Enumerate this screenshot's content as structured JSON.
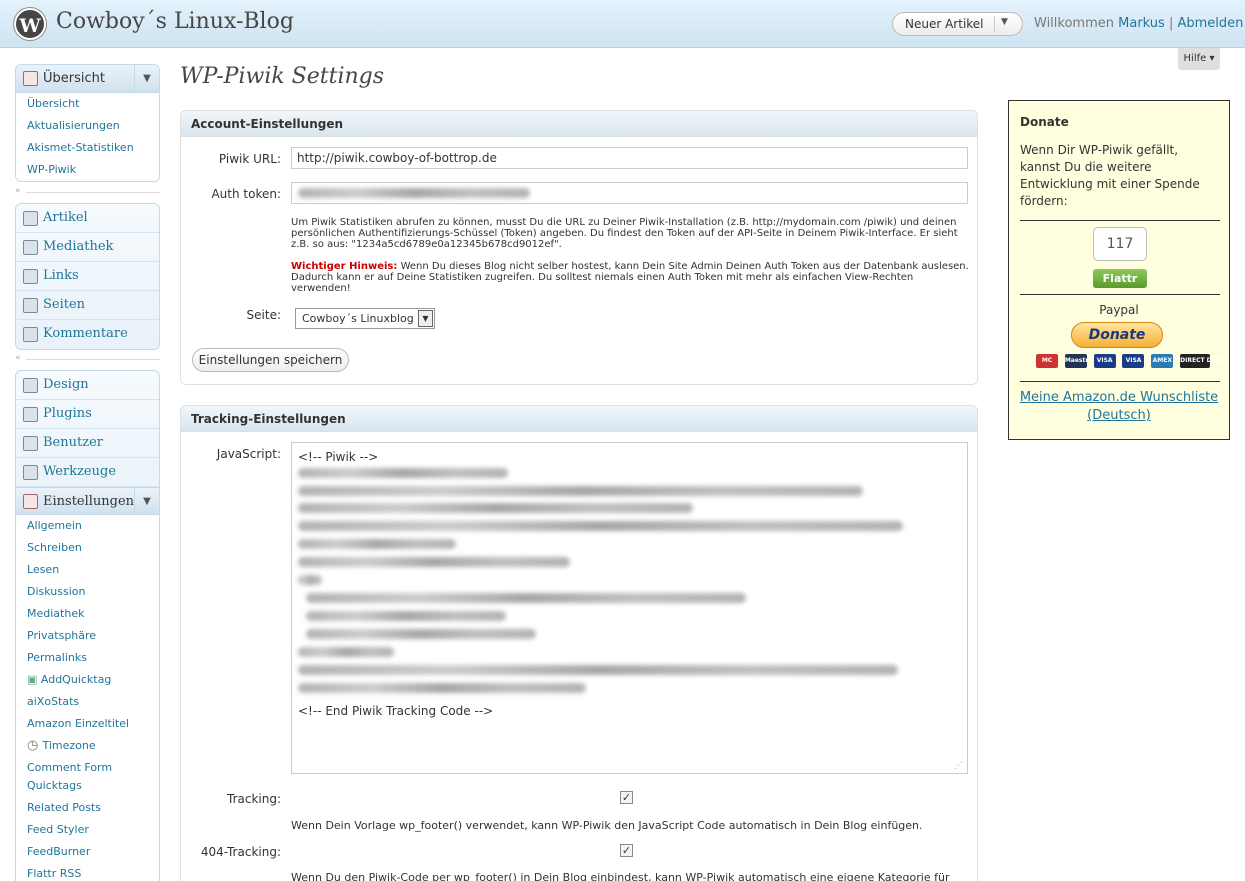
{
  "header": {
    "logo_glyph": "W",
    "site_title": "Cowboy´s Linux-Blog",
    "new_article_label": "Neuer Artikel",
    "welcome_text": "Willkommen",
    "user_name": "Markus",
    "divider": "|",
    "logout_label": "Abmelden",
    "help_label": "Hilfe ▾"
  },
  "sidebar": {
    "overview_group": {
      "title": "Übersicht",
      "items": [
        "Übersicht",
        "Aktualisierungen",
        "Akismet-Statistiken",
        "WP-Piwik"
      ]
    },
    "content_group": [
      "Artikel",
      "Mediathek",
      "Links",
      "Seiten",
      "Kommentare"
    ],
    "admin_group": [
      "Design",
      "Plugins",
      "Benutzer",
      "Werkzeuge"
    ],
    "settings_group": {
      "title": "Einstellungen",
      "items": [
        "Allgemein",
        "Schreiben",
        "Lesen",
        "Diskussion",
        "Mediathek",
        "Privatsphäre",
        "Permalinks",
        "AddQuicktag",
        "aiXoStats",
        "Amazon Einzeltitel",
        "Timezone",
        "Comment Form Quicktags",
        "Related Posts",
        "Feed Styler",
        "FeedBurner",
        "Flattr RSS"
      ]
    },
    "collapse_glyph": "«"
  },
  "main": {
    "title": "WP-Piwik Settings",
    "account": {
      "heading": "Account-Einstellungen",
      "piwik_url_label": "Piwik URL:",
      "piwik_url_value": "http://piwik.cowboy-of-bottrop.de",
      "auth_token_label": "Auth token:",
      "help_text": "Um Piwik Statistiken abrufen zu können, musst Du die URL zu Deiner Piwik-Installation (z.B. http://mydomain.com /piwik) und deinen persönlichen Authentifizierungs-Schüssel (Token) angeben. Du findest den Token auf der API-Seite in Deinem Piwik-Interface. Er sieht z.B. so aus: \"1234a5cd6789e0a12345b678cd9012ef\".",
      "warning_label": "Wichtiger Hinweis:",
      "warning_text": " Wenn Du dieses Blog nicht selber hostest, kann Dein Site Admin Deinen Auth Token aus der Datenbank auslesen. Dadurch kann er auf Deine Statistiken zugreifen. Du solltest niemals einen Auth Token mit mehr als einfachen View-Rechten verwenden!",
      "site_label": "Seite:",
      "site_value": "Cowboy´s Linuxblog",
      "save_label": "Einstellungen speichern"
    },
    "tracking": {
      "heading": "Tracking-Einstellungen",
      "javascript_label": "JavaScript:",
      "code_first": "<!-- Piwik -->",
      "code_last": "<!-- End Piwik Tracking Code -->",
      "tracking_label": "Tracking:",
      "tracking_checked": true,
      "tracking_help": "Wenn Dein Vorlage wp_footer() verwendet, kann WP-Piwik den JavaScript Code automatisch in Dein Blog einfügen.",
      "tracking404_label": "404-Tracking:",
      "tracking404_checked": true,
      "tracking404_help": "Wenn Du den Piwik-Code per wp_footer() in Dein Blog einbindest, kann WP-Piwik automatisch eine eigene Kategorie für"
    }
  },
  "donate": {
    "title": "Donate",
    "text": "Wenn Dir WP-Piwik gefällt, kannst Du die weitere Entwicklung mit einer Spende fördern:",
    "flattr_count": "117",
    "flattr_label": "Flattr",
    "paypal_label": "Paypal",
    "donate_button": "Donate",
    "cards": [
      "MC",
      "Maestro",
      "VISA",
      "VISA",
      "AMEX",
      "DIRECT Debit"
    ],
    "amazon_link": "Meine Amazon.de Wunschliste (Deutsch)"
  }
}
